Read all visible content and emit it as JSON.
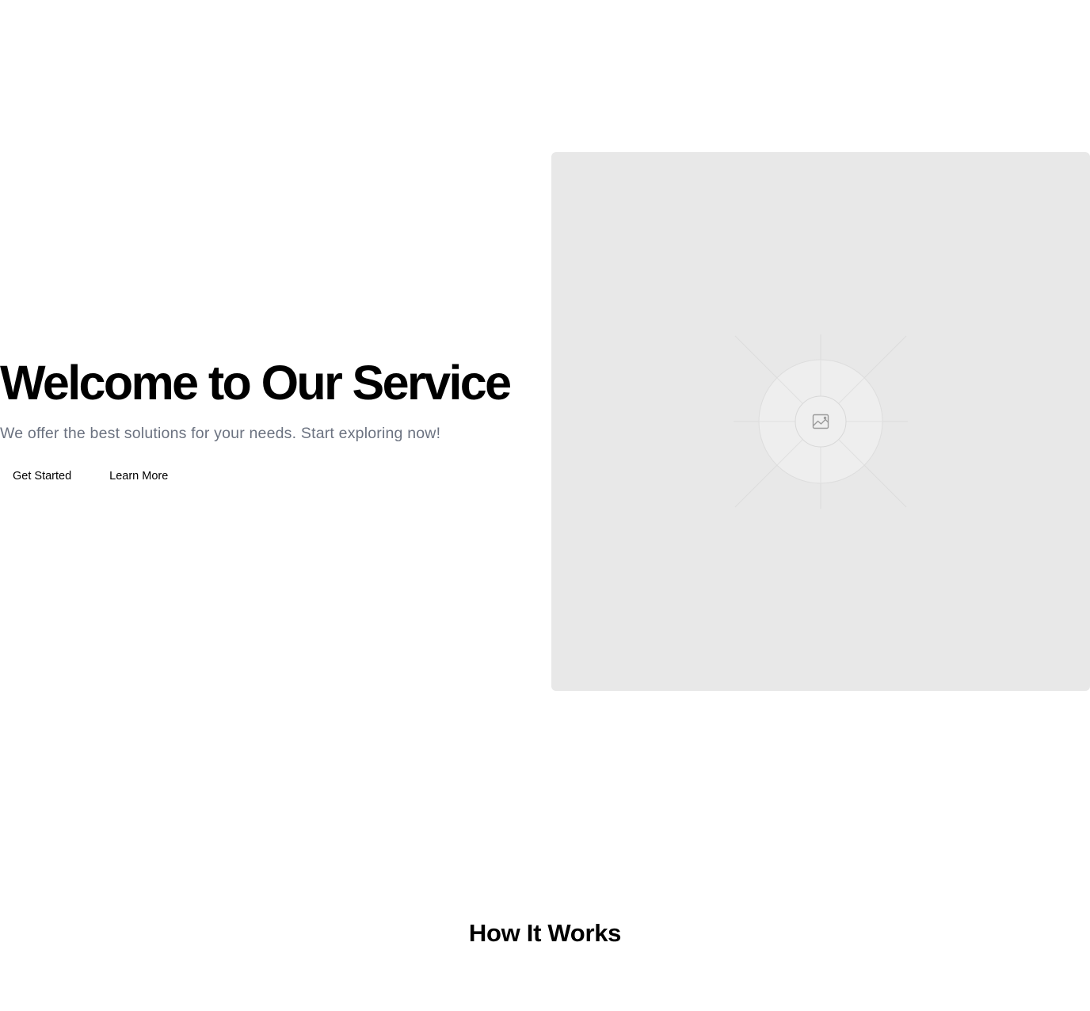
{
  "hero": {
    "title": "Welcome to Our Service",
    "subtitle": "We offer the best solutions for your needs. Start exploring now!",
    "primary_button": "Get Started",
    "secondary_button": "Learn More",
    "image": {
      "icon": "image-placeholder-icon",
      "background_color": "#e8e8e8"
    }
  },
  "how_it_works": {
    "title": "How It Works"
  },
  "colors": {
    "text": "#000000",
    "subtitle": "#6b7280",
    "placeholder_bg": "#e8e8e8"
  }
}
